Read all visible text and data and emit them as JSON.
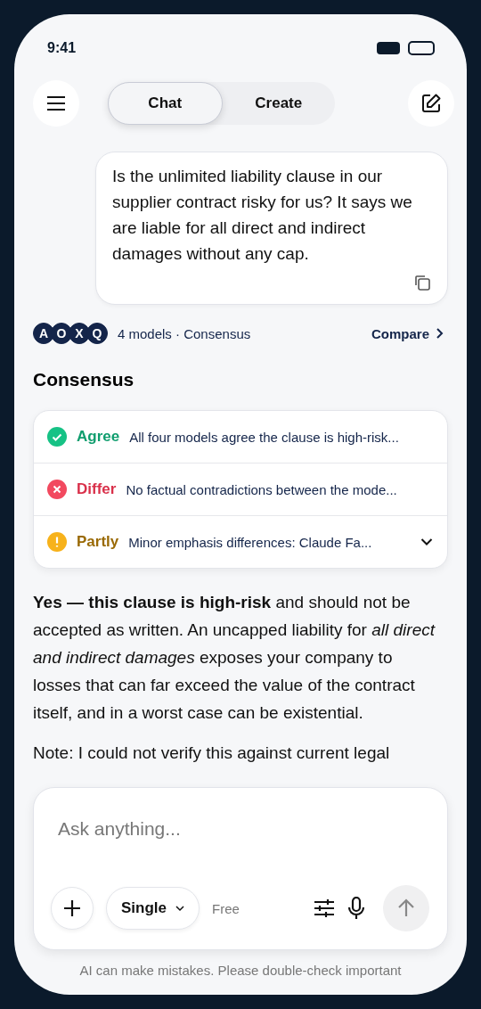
{
  "status_bar": {
    "time": "9:41"
  },
  "tabs": [
    {
      "label": "Chat",
      "selected": true
    },
    {
      "label": "Create",
      "selected": false
    }
  ],
  "message": {
    "text": "Is the unlimited liability clause in our supplier contract risky for us? It says we are liable for all direct and indirect damages without any cap."
  },
  "models": {
    "avatars": [
      "A",
      "O",
      "X",
      "Q"
    ],
    "summary": "4 models · Consensus",
    "compare": "Compare"
  },
  "consensus": {
    "title": "Consensus",
    "rows": [
      {
        "kind": "agree",
        "label": "Agree",
        "text": "All four models agree the clause is high-risk...",
        "collapsible": false
      },
      {
        "kind": "differ",
        "label": "Differ",
        "text": "No factual contradictions between the mode...",
        "collapsible": false
      },
      {
        "kind": "partly",
        "label": "Partly",
        "text": "Minor emphasis differences: Claude Fa...",
        "collapsible": true
      }
    ]
  },
  "answer": {
    "paragraph": "**Yes — this clause is high-risk** and should not be accepted as written. An uncapped liability for *all direct and indirect damages* exposes your company to losses that can far exceed the value of the contract itself, and in a worst case can be existential.",
    "note": "Note: I could not verify this against current legal"
  },
  "composer": {
    "placeholder": "Ask anything...",
    "mode": "Single",
    "plan": "Free"
  },
  "footer": "AI can make mistakes. Please double-check important"
}
